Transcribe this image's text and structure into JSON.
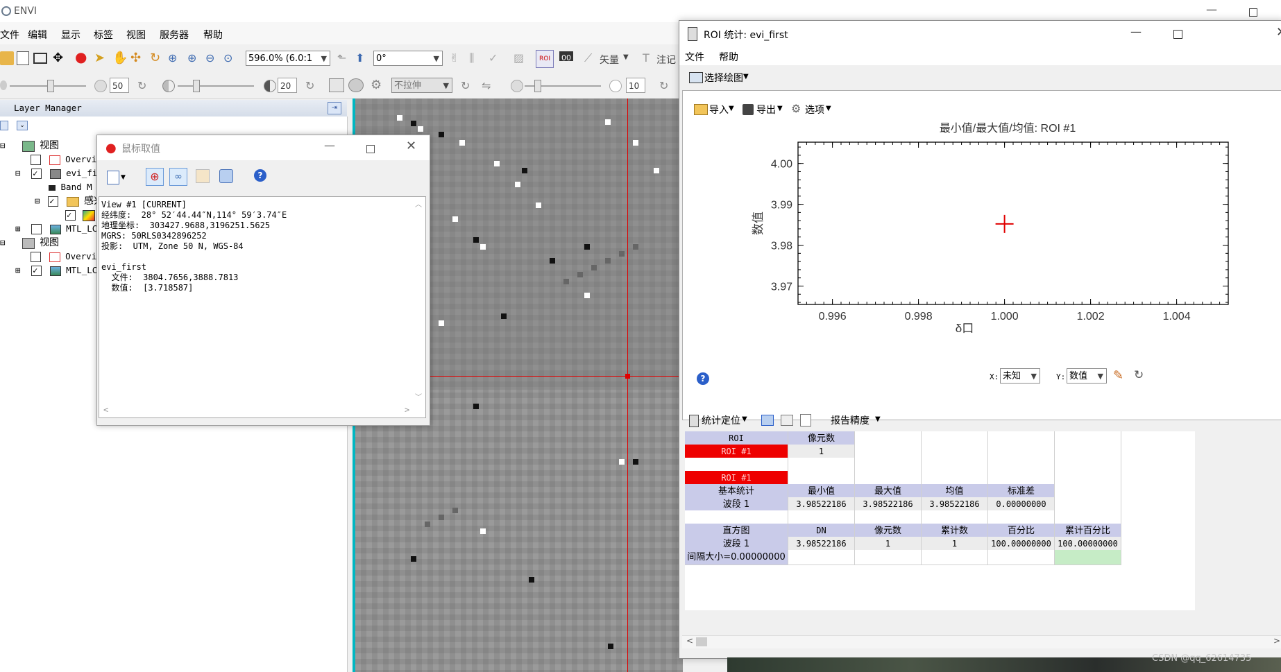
{
  "envi": {
    "title": "ENVI",
    "menus": [
      "文件",
      "编辑",
      "显示",
      "标签",
      "视图",
      "服务器",
      "帮助"
    ],
    "zoom_value": "596.0% (6.0:1",
    "rotation_value": "0°",
    "vector_label": "矢量",
    "annotate_label": "注记",
    "slider1_value": "50",
    "slider2_value": "20",
    "slider3_value": "10",
    "stretch_value": "不拉伸"
  },
  "layer_manager": {
    "title": "Layer Manager",
    "rows": [
      {
        "label": "视图"
      },
      {
        "label": "Overvie"
      },
      {
        "label": "evi_fir"
      },
      {
        "label": "Band M"
      },
      {
        "label": "感兴"
      },
      {
        "label": ""
      },
      {
        "label": "MTL_LCO"
      },
      {
        "label": "视图"
      },
      {
        "label": "Overvie"
      },
      {
        "label": "MTL_LCO"
      }
    ]
  },
  "cursor_value": {
    "title": "鼠标取值",
    "lines": [
      "View #1 [CURRENT]",
      "经纬度:  28° 52′44.44″N,114° 59′3.74″E",
      "地理坐标:  303427.9688,3196251.5625",
      "MGRS: 50RLS0342896252",
      "投影:  UTM, Zone 50 N, WGS-84",
      "",
      "evi_first",
      "  文件:  3804.7656,3888.7813",
      "  数值:  [3.718587]"
    ]
  },
  "roi_window": {
    "title": "ROI 统计: evi_first",
    "menus": [
      "文件",
      "帮助"
    ],
    "select_plot_label": "选择绘图",
    "import_label": "导入",
    "export_label": "导出",
    "options_label": "选项",
    "stats_locate_label": "统计定位",
    "report_precision_label": "报告精度",
    "x_axis_label": "X:",
    "x_axis_value": "未知",
    "y_axis_label": "Y:",
    "y_axis_value": "数值",
    "table": {
      "roi_header": "ROI",
      "pixel_count_header": "像元数",
      "roi_name": "ROI #1",
      "roi_pixel_count": "1",
      "basic_stats_label": "基本统计",
      "stat_headers": [
        "最小值",
        "最大值",
        "均值",
        "标准差"
      ],
      "band_label": "波段 1",
      "stat_values": [
        "3.98522186",
        "3.98522186",
        "3.98522186",
        "0.00000000"
      ],
      "histogram_label": "直方图",
      "hist_headers": [
        "DN",
        "像元数",
        "累计数",
        "百分比",
        "累计百分比"
      ],
      "hist_values": [
        "3.98522186",
        "1",
        "1",
        "100.00000000",
        "100.00000000"
      ],
      "interval_label": "间隔大小=0.00000000"
    }
  },
  "watermark": "CSDN @qq_62614735",
  "chart_data": {
    "type": "scatter",
    "title": "最小值/最大值/均值: ROI #1",
    "xlabel": "δ口",
    "ylabel": "数值",
    "x_ticks": [
      "0.996",
      "0.998",
      "1.000",
      "1.002",
      "1.004"
    ],
    "y_ticks": [
      "4.00",
      "3.99",
      "3.98",
      "3.97"
    ],
    "xlim": [
      0.9952,
      1.0052
    ],
    "ylim": [
      3.9655,
      4.0052
    ],
    "series": [
      {
        "marker": "+",
        "color": "#e00000",
        "points": [
          {
            "x": 1.0,
            "y": 3.9852
          }
        ]
      }
    ]
  }
}
